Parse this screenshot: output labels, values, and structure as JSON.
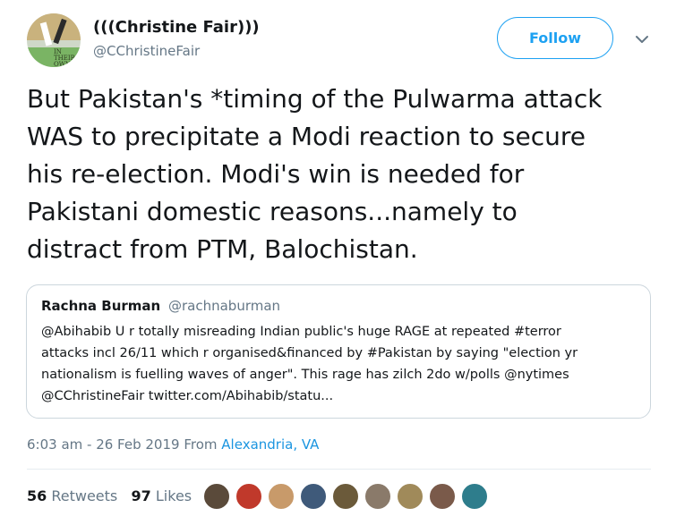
{
  "author": {
    "name": "(((Christine Fair)))",
    "handle": "@CChristineFair",
    "avatar_text": "IN THEIR OWN"
  },
  "follow_label": "Follow",
  "tweet": {
    "lines": [
      "But Pakistan's *timing of the Pulwarma attack",
      "WAS to precipitate a Modi reaction to secure",
      "his re-election. Modi's win is needed for",
      "Pakistani domestic reasons...namely to",
      "distract from PTM, Balochistan."
    ]
  },
  "quote": {
    "name": "Rachna Burman",
    "handle": "@rachnaburman",
    "lines": [
      "@Abihabib U r totally misreading Indian public's huge RAGE at repeated #terror",
      "attacks incl 26/11 which r organised&financed by #Pakistan by saying \"election yr",
      "nationalism is fuelling waves of anger\". This rage has zilch 2do w/polls @nytimes",
      "@CChristineFair twitter.com/Abihabib/statu..."
    ]
  },
  "meta": {
    "time": "6:03 am - 26 Feb 2019",
    "from": "From",
    "location": "Alexandria, VA"
  },
  "stats": {
    "retweets_count": "56",
    "retweets_label": "Retweets",
    "likes_count": "97",
    "likes_label": "Likes"
  },
  "colors": {
    "accent": "#1da1f2",
    "link": "#1b95e0",
    "muted": "#657786",
    "text": "#14171a",
    "border": "#ccd6dd"
  },
  "likers": [
    {
      "color": "#5a4a3a"
    },
    {
      "color": "#c0392b"
    },
    {
      "color": "#c89a6a"
    },
    {
      "color": "#3f5a7a"
    },
    {
      "color": "#6b5a3a"
    },
    {
      "color": "#8a7a6a"
    },
    {
      "color": "#a08a5a"
    },
    {
      "color": "#7a5a4a"
    },
    {
      "color": "#2e7d8c"
    }
  ]
}
